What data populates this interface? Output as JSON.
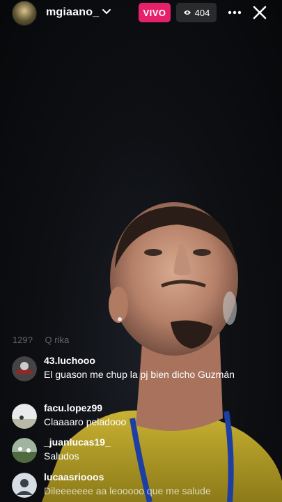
{
  "header": {
    "username": "mgiaano_",
    "live_label": "VIVO",
    "viewer_count": "404"
  },
  "faded_comment": {
    "username": "129?",
    "text": "Q rika"
  },
  "comments": [
    {
      "username": "43.luchooo",
      "text": "El guason me chup la pj bien dicho Guzmán"
    },
    {
      "username": "facu.lopez99",
      "text": "Claaaaro peladooo"
    },
    {
      "username": "_juanlucas19_",
      "text": "Saludos"
    },
    {
      "username": "lucaasriooos",
      "text": "Dileeeeeee aa leooooo que me salude"
    }
  ],
  "colors": {
    "live_badge": "#e6216b",
    "background": "#0c0d10"
  }
}
